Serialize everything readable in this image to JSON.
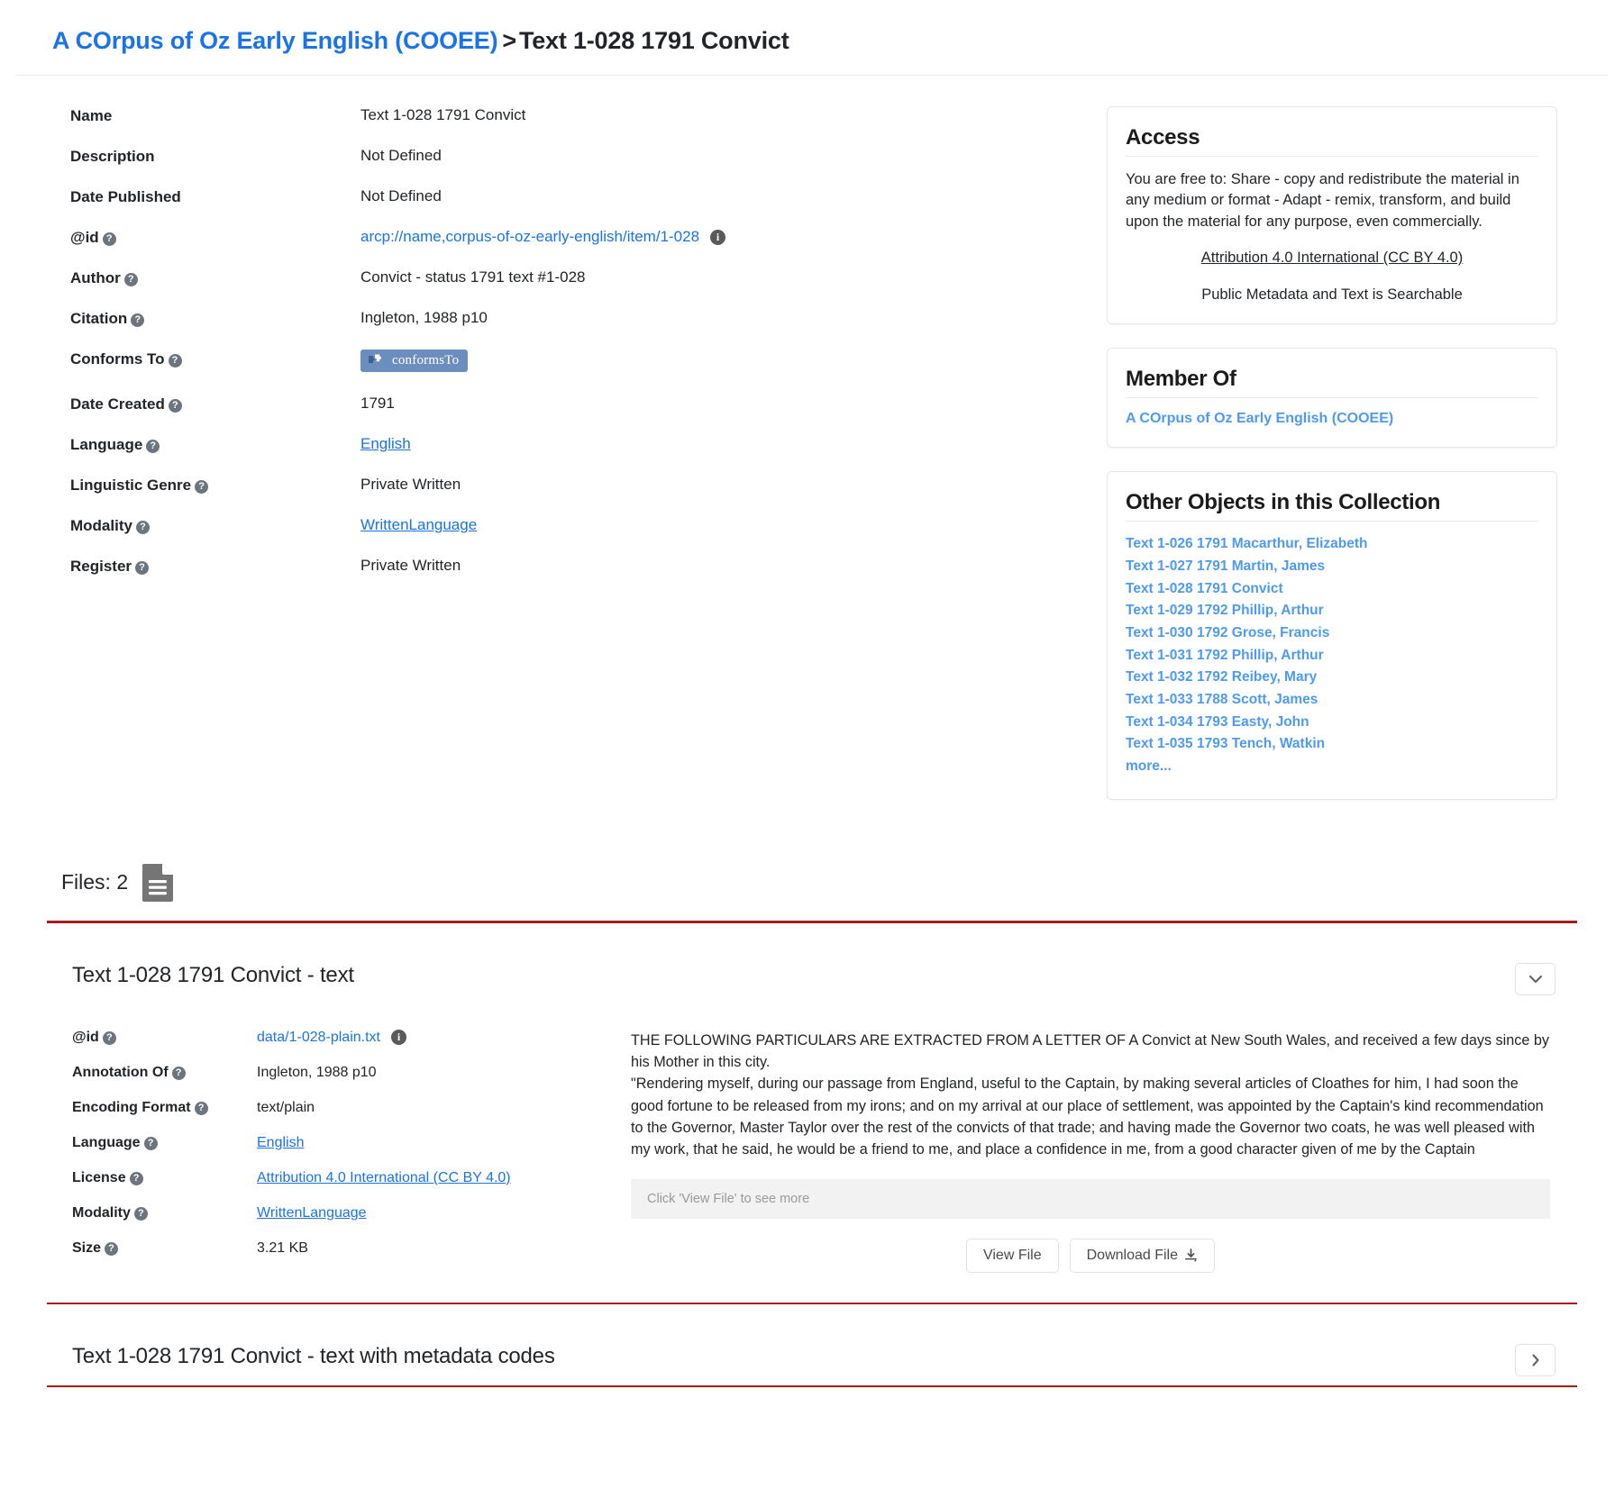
{
  "breadcrumb": {
    "collection_link": "A COrpus of Oz Early English (COOEE)",
    "separator": ">",
    "current": "Text 1-028 1791 Convict"
  },
  "metadata": {
    "rows": [
      {
        "label": "Name",
        "help": false,
        "value": "Text 1-028 1791 Convict",
        "kind": "text"
      },
      {
        "label": "Description",
        "help": false,
        "value": "Not Defined",
        "kind": "text"
      },
      {
        "label": "Date Published",
        "help": false,
        "value": "Not Defined",
        "kind": "text"
      },
      {
        "label": "@id",
        "help": true,
        "value": "arcp://name,corpus-of-oz-early-english/item/1-028",
        "kind": "link-info"
      },
      {
        "label": "Author",
        "help": true,
        "value": "Convict - status 1791 text #1-028",
        "kind": "text"
      },
      {
        "label": "Citation",
        "help": true,
        "value": "Ingleton, 1988 p10",
        "kind": "text"
      },
      {
        "label": "Conforms To",
        "help": true,
        "value": "conformsTo",
        "kind": "badge"
      },
      {
        "label": "Date Created",
        "help": true,
        "value": "1791",
        "kind": "text"
      },
      {
        "label": "Language",
        "help": true,
        "value": "English",
        "kind": "link"
      },
      {
        "label": "Linguistic Genre",
        "help": true,
        "value": "Private Written",
        "kind": "text"
      },
      {
        "label": "Modality",
        "help": true,
        "value": "WrittenLanguage",
        "kind": "link"
      },
      {
        "label": "Register",
        "help": true,
        "value": "Private Written",
        "kind": "text"
      }
    ]
  },
  "access_card": {
    "title": "Access",
    "body": "You are free to: Share - copy and redistribute the material in any medium or format - Adapt - remix, transform, and build upon the material for any purpose, even commercially.",
    "license_link": "Attribution 4.0 International (CC BY 4.0)",
    "searchable": "Public Metadata and Text is Searchable"
  },
  "member_of_card": {
    "title": "Member Of",
    "link": "A COrpus of Oz Early English (COOEE)"
  },
  "other_objects_card": {
    "title": "Other Objects in this Collection",
    "items": [
      "Text 1-026 1791 Macarthur, Elizabeth",
      "Text 1-027 1791 Martin, James",
      "Text 1-028 1791 Convict",
      "Text 1-029 1792 Phillip, Arthur",
      "Text 1-030 1792 Grose, Francis",
      "Text 1-031 1792 Phillip, Arthur",
      "Text 1-032 1792 Reibey, Mary",
      "Text 1-033 1788 Scott, James",
      "Text 1-034 1793 Easty, John",
      "Text 1-035 1793 Tench, Watkin"
    ],
    "more_label": "more..."
  },
  "files": {
    "count_label": "Files: 2",
    "icon": "document-icon"
  },
  "file_panel_1": {
    "title": "Text 1-028 1791 Convict - text",
    "expanded": true,
    "chevron": "chevron-down-icon",
    "rows": [
      {
        "label": "@id",
        "value": "data/1-028-plain.txt",
        "kind": "link-info"
      },
      {
        "label": "Annotation Of",
        "value": "Ingleton, 1988 p10",
        "kind": "text"
      },
      {
        "label": "Encoding Format",
        "value": "text/plain",
        "kind": "text"
      },
      {
        "label": "Language",
        "value": "English",
        "kind": "link"
      },
      {
        "label": "License",
        "value": "Attribution 4.0 International (CC BY 4.0)",
        "kind": "link"
      },
      {
        "label": "Modality",
        "value": "WrittenLanguage",
        "kind": "link"
      },
      {
        "label": "Size",
        "value": "3.21 KB",
        "kind": "text"
      }
    ],
    "preview": "THE FOLLOWING PARTICULARS ARE EXTRACTED FROM A LETTER OF A Convict at New South Wales, and received a few days since by his Mother in this city.\n\"Rendering myself, during our passage from England, useful to the Captain, by making several articles of Cloathes for him, I had soon the good fortune to be released from my irons; and on my arrival at our place of settlement, was appointed by the Captain's kind recommendation to the Governor, Master Taylor over the rest of the convicts of that trade; and having made the Governor two coats, he was well pleased with my work, that he said, he would be a friend to me, and place a confidence in me, from a good character given of me by the Captain",
    "more_hint": "Click 'View File' to see more",
    "view_button": "View File",
    "download_button": "Download File"
  },
  "file_panel_2": {
    "title": "Text 1-028 1791 Convict - text with metadata codes",
    "expanded": false,
    "chevron": "chevron-right-icon"
  },
  "colors": {
    "link_blue": "#1a73e8",
    "soft_blue": "#4d9af3",
    "divider_red": "#a61c1c",
    "badge_blue": "#6c8ebf"
  }
}
